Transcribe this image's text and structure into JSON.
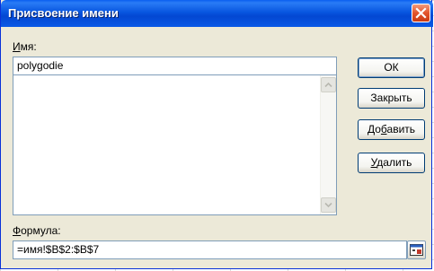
{
  "window": {
    "title": "Присвоение имени"
  },
  "name_field": {
    "label_underlined": "И",
    "label_rest": "мя:",
    "value": "polygodie"
  },
  "names_list": {
    "items": []
  },
  "buttons": {
    "ok": "ОК",
    "close": "Закрыть",
    "add_pre": "До",
    "add_u": "б",
    "add_post": "авить",
    "delete_u": "У",
    "delete_rest": "далить"
  },
  "formula_field": {
    "label_underlined": "Ф",
    "label_rest": "ормула:",
    "value": "=имя!$B$2:$B$7"
  },
  "icons": [
    "close-icon",
    "scroll-up-icon",
    "scroll-down-icon",
    "collapse-dialog-icon"
  ]
}
